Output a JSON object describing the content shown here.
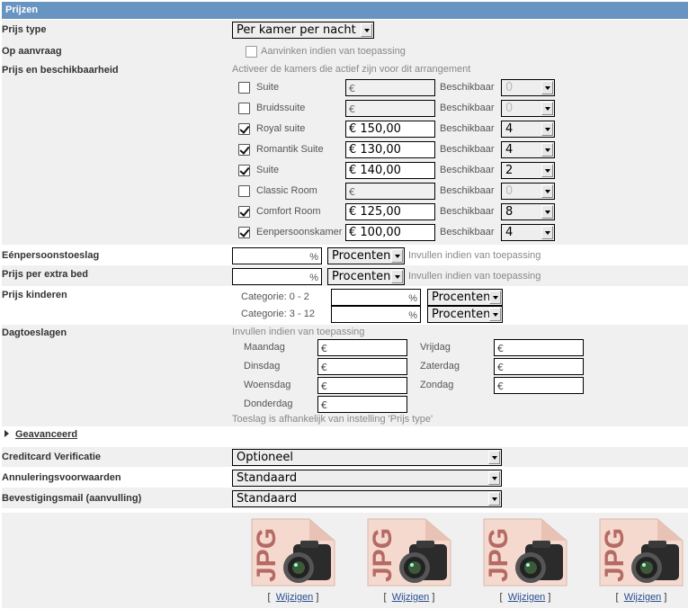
{
  "section_title": "Prijzen",
  "prijs_type": {
    "label": "Prijs type",
    "value": "Per kamer per nacht"
  },
  "op_aanvraag": {
    "label": "Op aanvraag",
    "checkbox_label": "Aanvinken indien van toepassing",
    "checked": false
  },
  "beschikbaarheid": {
    "label": "Prijs en beschikbaarheid",
    "hint": "Activeer de kamers die actief zijn voor dit arrangement",
    "availability_label": "Beschikbaar",
    "rooms": [
      {
        "name": "Suite",
        "checked": false,
        "price": "€",
        "available": "0"
      },
      {
        "name": "Bruidssuite",
        "checked": false,
        "price": "€",
        "available": "0"
      },
      {
        "name": "Royal suite",
        "checked": true,
        "price": "€ 150,00",
        "available": "4"
      },
      {
        "name": "Romantik Suite",
        "checked": true,
        "price": "€ 130,00",
        "available": "4"
      },
      {
        "name": "Suite",
        "checked": true,
        "price": "€ 140,00",
        "available": "2"
      },
      {
        "name": "Classic Room",
        "checked": false,
        "price": "€",
        "available": "0"
      },
      {
        "name": "Comfort Room",
        "checked": true,
        "price": "€ 125,00",
        "available": "8"
      },
      {
        "name": "Eenpersoonskamer",
        "checked": true,
        "price": "€ 100,00",
        "available": "4"
      }
    ]
  },
  "eenpersoonstoeslag": {
    "label": "Eénpersoonstoeslag",
    "value": "",
    "unit": "%",
    "type": "Procenten",
    "hint": "Invullen indien van toepassing"
  },
  "extra_bed": {
    "label": "Prijs per extra bed",
    "value": "",
    "unit": "%",
    "type": "Procenten",
    "hint": "Invullen indien van toepassing"
  },
  "kinderen": {
    "label": "Prijs kinderen",
    "categories": [
      {
        "label": "Categorie: 0 - 2",
        "unit": "%",
        "type": "Procenten"
      },
      {
        "label": "Categorie: 3 - 12",
        "unit": "%",
        "type": "Procenten"
      }
    ]
  },
  "dagtoeslagen": {
    "label": "Dagtoeslagen",
    "hint": "Invullen indien van toepassing",
    "footer": "Toeslag is afhankelijk van instelling 'Prijs type'",
    "days": [
      {
        "label": "Maandag",
        "value": "€"
      },
      {
        "label": "Dinsdag",
        "value": "€"
      },
      {
        "label": "Woensdag",
        "value": "€"
      },
      {
        "label": "Donderdag",
        "value": "€"
      },
      {
        "label": "Vrijdag",
        "value": "€"
      },
      {
        "label": "Zaterdag",
        "value": "€"
      },
      {
        "label": "Zondag",
        "value": "€"
      }
    ]
  },
  "advanced": {
    "label": "Geavanceerd"
  },
  "creditcard": {
    "label": "Creditcard Verificatie",
    "value": "Optioneel"
  },
  "annulering": {
    "label": "Annuleringsvoorwaarden",
    "value": "Standaard"
  },
  "bevestiging": {
    "label": "Bevestigingsmail (aanvulling)",
    "value": "Standaard"
  },
  "photos": {
    "icon_text": "JPG",
    "link_label": "Wijzigen",
    "bracket_open": "[",
    "bracket_close": "]",
    "count": 4
  }
}
